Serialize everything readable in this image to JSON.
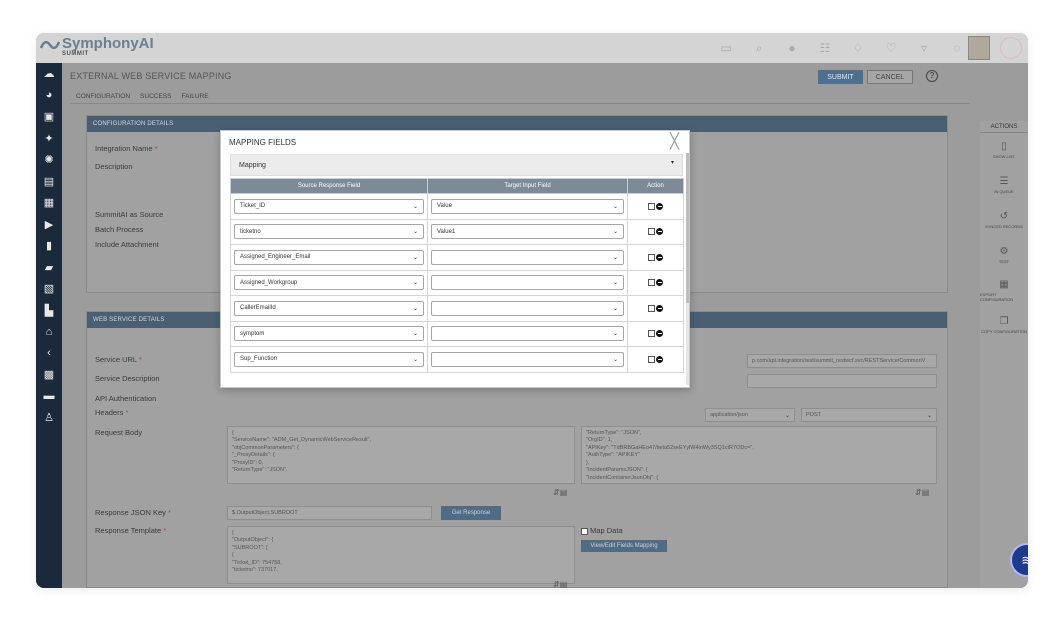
{
  "app": {
    "brand": "SymphonyAI",
    "product": "SUMMIT"
  },
  "page": {
    "title": "EXTERNAL WEB SERVICE MAPPING",
    "submit_label": "SUBMIT",
    "cancel_label": "CANCEL",
    "tabs": [
      {
        "label": "CONFIGURATION",
        "active": true
      },
      {
        "label": "SUCCESS"
      },
      {
        "label": "FAILURE"
      }
    ]
  },
  "config_panel": {
    "header": "CONFIGURATION DETAILS",
    "integration_name_label": "Integration Name",
    "description_label": "Description",
    "summitai_source_label": "SummitAI as Source",
    "batch_process_label": "Batch Process",
    "include_attachment_label": "Include Attachment"
  },
  "ws_panel": {
    "header": "WEB SERVICE DETAILS",
    "service_url_label": "Service URL",
    "service_url_value": "p.com/api.integration/rest/summit_restwcf.svc/RESTService/CommonV",
    "service_description_label": "Service Description",
    "api_auth_label": "API Authentication",
    "headers_label": "Headers",
    "content_type_value": "application/json",
    "method_value": "POST",
    "request_body_label": "Request Body",
    "request_body_text": [
      "{",
      "    \"ServiceName\": \"ADM_Get_DynamicWebServiceResult\",",
      "    \"objCommonParameters\": {",
      "        \"_ProxyDetails\": {",
      "            \"ProxyID\": 0,",
      "            \"ReturnType\": \"JSON\","
    ],
    "request_body_right_text": [
      "    \"ReturnType\": \"JSON\",",
      "    \"OrgID\": 1,",
      "    \"APIKey\": \"TdBRBGaHEo47/tieta52seEYylW4inWy3SQ1ctR7ODc=\",",
      "    \"AuthType\": \"APIKEY\"",
      "},",
      "\"IncidentParamsJSON\": {",
      "    \"IncidentContainerJsonObj\": {"
    ],
    "response_json_key_label": "Response JSON Key",
    "response_json_key_value": "$.OutputObject.SUBROOT",
    "get_response_label": "Get Response",
    "response_template_label": "Response Template",
    "response_template_text": [
      "{",
      "    \"OutputObject\": {",
      "        \"SUBROOT\": [",
      "            {",
      "                \"Ticket_ID\": 754758,",
      "                \"ticketno\": 737017,"
    ],
    "map_data_label": "Map Data",
    "view_edit_label": "View/Edit Fields Mapping"
  },
  "actions": {
    "header": "ACTIONS",
    "items": [
      {
        "label": "SHOW LIST",
        "icon": "document-icon"
      },
      {
        "label": "IN QUEUE",
        "icon": "list-icon"
      },
      {
        "label": "SYNCED RECORDS",
        "icon": "history-icon"
      },
      {
        "label": "TEST",
        "icon": "gear-icon"
      },
      {
        "label": "EXPORT CONFIGURATION",
        "icon": "export-icon"
      },
      {
        "label": "COPY CONFIGURATION",
        "icon": "copy-icon"
      }
    ]
  },
  "modal": {
    "title": "MAPPING FIELDS",
    "section": "Mapping",
    "columns": [
      "Source Response Field",
      "Target Input Field",
      "Action"
    ],
    "rows": [
      {
        "source": "Ticket_ID",
        "target": "Value"
      },
      {
        "source": "ticketno",
        "target": "Value1"
      },
      {
        "source": "Assigned_Engineer_Email",
        "target": ""
      },
      {
        "source": "Assigned_Workgroup",
        "target": ""
      },
      {
        "source": "CallerEmailId",
        "target": ""
      },
      {
        "source": "symptom",
        "target": ""
      },
      {
        "source": "Sup_Function",
        "target": ""
      }
    ]
  },
  "colors": {
    "nav_bg": "#1a2a3a",
    "panel_header": "#4b5f73",
    "table_header": "#7d8b98",
    "accent": "#1e3a8a"
  }
}
